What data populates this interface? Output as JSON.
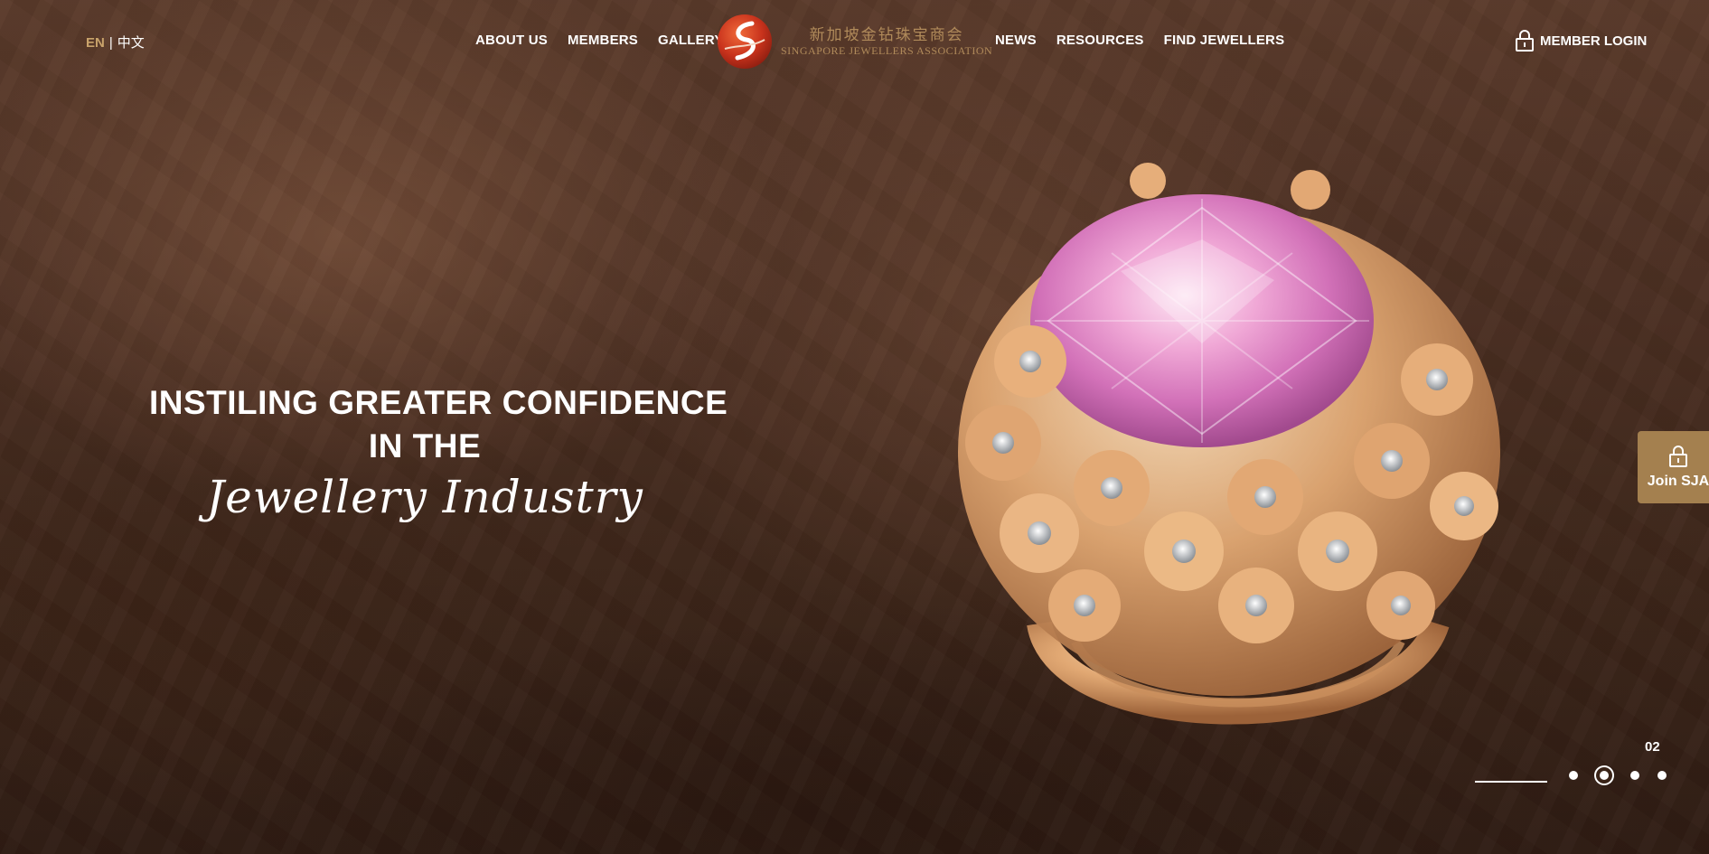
{
  "header": {
    "lang_en": "EN",
    "lang_sep": "|",
    "lang_zh": "中文",
    "nav_left": [
      "ABOUT US",
      "MEMBERS",
      "GALLERY"
    ],
    "nav_right": [
      "NEWS",
      "RESOURCES",
      "FIND JEWELLERS"
    ],
    "logo_cn": "新加坡金钻珠宝商会",
    "logo_en": "SINGAPORE JEWELLERS ASSOCIATION",
    "member_login": "MEMBER LOGIN"
  },
  "hero": {
    "line1": "INSTILING GREATER CONFIDENCE",
    "line2": "IN THE",
    "script": "Jewellery Industry"
  },
  "join": {
    "label": "Join SJA"
  },
  "slider": {
    "counter": "02",
    "total_dots": 4,
    "active_index": 1
  },
  "colors": {
    "accent": "#c9a36b",
    "join_bg": "#a4804f",
    "background": "#3a2418"
  },
  "icons": [
    "lock-icon",
    "logo-emblem-icon"
  ]
}
